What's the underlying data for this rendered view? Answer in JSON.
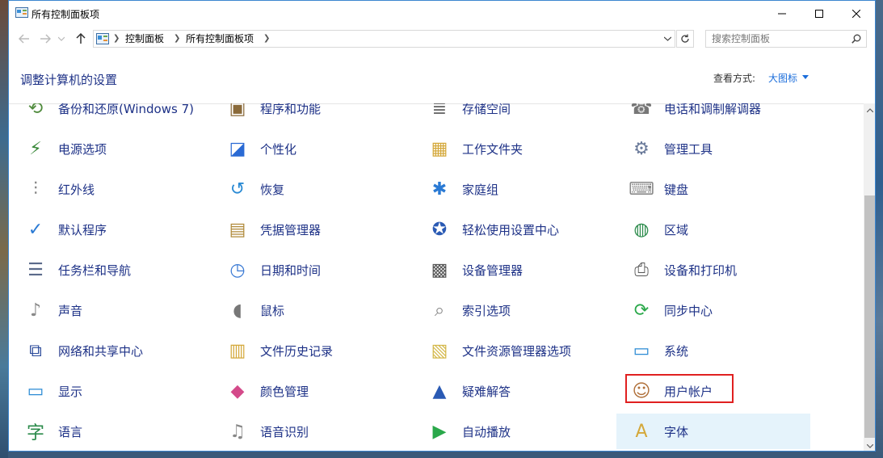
{
  "window": {
    "title": "所有控制面板项"
  },
  "address": {
    "crumbs": [
      "控制面板",
      "所有控制面板项"
    ]
  },
  "search": {
    "placeholder": "搜索控制面板"
  },
  "header": {
    "title": "调整计算机的设置",
    "view_label": "查看方式:",
    "view_value": "大图标"
  },
  "items": [
    [
      {
        "label": "备份和还原(Windows 7)",
        "icon": "backup-icon"
      },
      {
        "label": "电源选项",
        "icon": "power-icon"
      },
      {
        "label": "红外线",
        "icon": "infrared-icon"
      },
      {
        "label": "默认程序",
        "icon": "default-programs-icon"
      },
      {
        "label": "任务栏和导航",
        "icon": "taskbar-icon"
      },
      {
        "label": "声音",
        "icon": "sound-icon"
      },
      {
        "label": "网络和共享中心",
        "icon": "network-icon"
      },
      {
        "label": "显示",
        "icon": "display-icon"
      },
      {
        "label": "语言",
        "icon": "language-icon"
      }
    ],
    [
      {
        "label": "程序和功能",
        "icon": "programs-icon"
      },
      {
        "label": "个性化",
        "icon": "personalization-icon"
      },
      {
        "label": "恢复",
        "icon": "recovery-icon"
      },
      {
        "label": "凭据管理器",
        "icon": "credential-icon"
      },
      {
        "label": "日期和时间",
        "icon": "datetime-icon"
      },
      {
        "label": "鼠标",
        "icon": "mouse-icon"
      },
      {
        "label": "文件历史记录",
        "icon": "file-history-icon"
      },
      {
        "label": "颜色管理",
        "icon": "color-icon"
      },
      {
        "label": "语音识别",
        "icon": "microphone-icon"
      }
    ],
    [
      {
        "label": "存储空间",
        "icon": "storage-icon"
      },
      {
        "label": "工作文件夹",
        "icon": "work-folders-icon"
      },
      {
        "label": "家庭组",
        "icon": "homegroup-icon"
      },
      {
        "label": "轻松使用设置中心",
        "icon": "ease-of-access-icon"
      },
      {
        "label": "设备管理器",
        "icon": "device-manager-icon"
      },
      {
        "label": "索引选项",
        "icon": "indexing-icon"
      },
      {
        "label": "文件资源管理器选项",
        "icon": "folder-options-icon"
      },
      {
        "label": "疑难解答",
        "icon": "troubleshoot-icon"
      },
      {
        "label": "自动播放",
        "icon": "autoplay-icon"
      }
    ],
    [
      {
        "label": "电话和调制解调器",
        "icon": "phone-icon"
      },
      {
        "label": "管理工具",
        "icon": "admin-tools-icon"
      },
      {
        "label": "键盘",
        "icon": "keyboard-icon"
      },
      {
        "label": "区域",
        "icon": "region-icon"
      },
      {
        "label": "设备和打印机",
        "icon": "printer-icon"
      },
      {
        "label": "同步中心",
        "icon": "sync-icon"
      },
      {
        "label": "系统",
        "icon": "system-icon"
      },
      {
        "label": "用户帐户",
        "icon": "user-accounts-icon"
      },
      {
        "label": "字体",
        "icon": "fonts-icon"
      }
    ]
  ],
  "colors": {
    "link": "#1e3287",
    "accent": "#1a6ddb",
    "highlight_box": "#e02020"
  }
}
